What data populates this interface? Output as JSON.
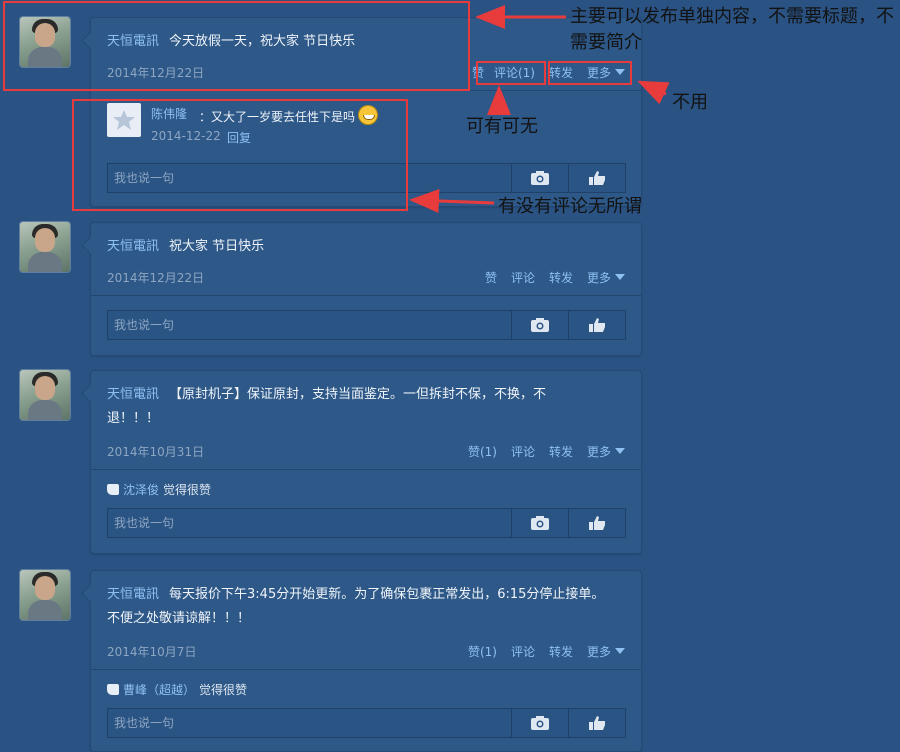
{
  "posts": [
    {
      "author": "天恒電訊",
      "text": "今天放假一天，祝大家 节日快乐",
      "date": "2014年12月22日",
      "actions": {
        "like": "赞",
        "comment": "评论(1)",
        "share": "转发",
        "more": "更多"
      },
      "comments": [
        {
          "name": "陈伟隆",
          "text": "：又大了一岁要去任性下是吗",
          "date": "2014-12-22",
          "reply": "回复"
        }
      ],
      "reply_placeholder": "我也说一句"
    },
    {
      "author": "天恒電訊",
      "text": "祝大家 节日快乐",
      "date": "2014年12月22日",
      "actions": {
        "like": "赞",
        "comment": "评论",
        "share": "转发",
        "more": "更多"
      },
      "reply_placeholder": "我也说一句"
    },
    {
      "author": "天恒電訊",
      "text": "【原封机子】保证原封，支持当面鉴定。一但拆封不保，不换，不退！！！",
      "date": "2014年10月31日",
      "actions": {
        "like": "赞(1)",
        "comment": "评论",
        "share": "转发",
        "more": "更多"
      },
      "likes": {
        "name": "沈泽俊",
        "text": "觉得很赞"
      },
      "reply_placeholder": "我也说一句"
    },
    {
      "author": "天恒電訊",
      "text": "每天报价下午3:45分开始更新。为了确保包裹正常发出，6:15分停止接单。不便之处敬请谅解！！！",
      "date": "2014年10月7日",
      "actions": {
        "like": "赞(1)",
        "comment": "评论",
        "share": "转发",
        "more": "更多"
      },
      "likes": {
        "name": "曹峰（超越）",
        "text": "觉得很赞"
      },
      "reply_placeholder": "我也说一句"
    }
  ],
  "annotations": {
    "main_content": "主要可以发布单独内容，不需要标题，不需要简介",
    "optional": "可有可无",
    "not_needed": "不用",
    "comments_optional": "有没有评论无所谓"
  },
  "colors": {
    "background": "#2a5384",
    "card": "#2d5888",
    "link": "#8ec0f2",
    "annotation_red": "#e83b3b"
  }
}
